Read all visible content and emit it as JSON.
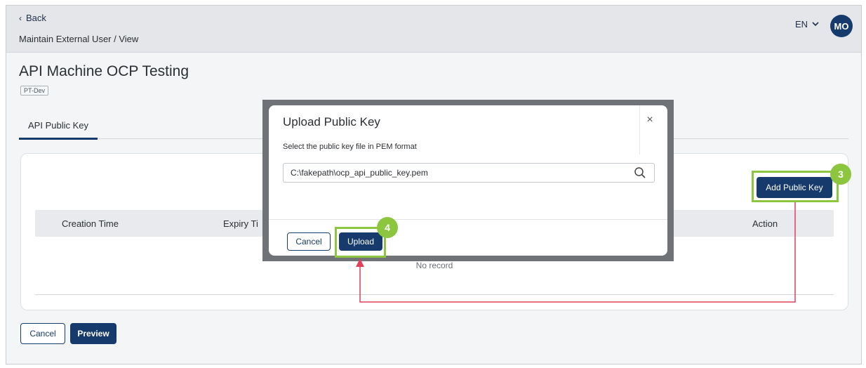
{
  "header": {
    "back_label": "Back",
    "breadcrumb": "Maintain External User / View",
    "language": "EN",
    "avatar_initials": "MO"
  },
  "page": {
    "title": "API Machine OCP Testing",
    "env_badge": "PT-Dev",
    "tabs": [
      {
        "label": "API Public Key"
      }
    ]
  },
  "card": {
    "add_button_label": "Add Public Key",
    "columns": [
      "Creation Time",
      "Expiry Ti",
      "Action"
    ],
    "empty_text": "No record"
  },
  "footer": {
    "cancel_label": "Cancel",
    "preview_label": "Preview"
  },
  "modal": {
    "title": "Upload Public Key",
    "close_glyph": "×",
    "instruction": "Select the public key file in PEM format",
    "file_value": "C:\\fakepath\\ocp_api_public_key.pem",
    "cancel_label": "Cancel",
    "upload_label": "Upload"
  },
  "annotations": {
    "step_add": "3",
    "step_upload": "4",
    "highlight_color": "#8cc63f",
    "arrow_color": "#e0405a"
  },
  "colors": {
    "primary": "#163a6b",
    "topbar": "#e4e6e9"
  }
}
